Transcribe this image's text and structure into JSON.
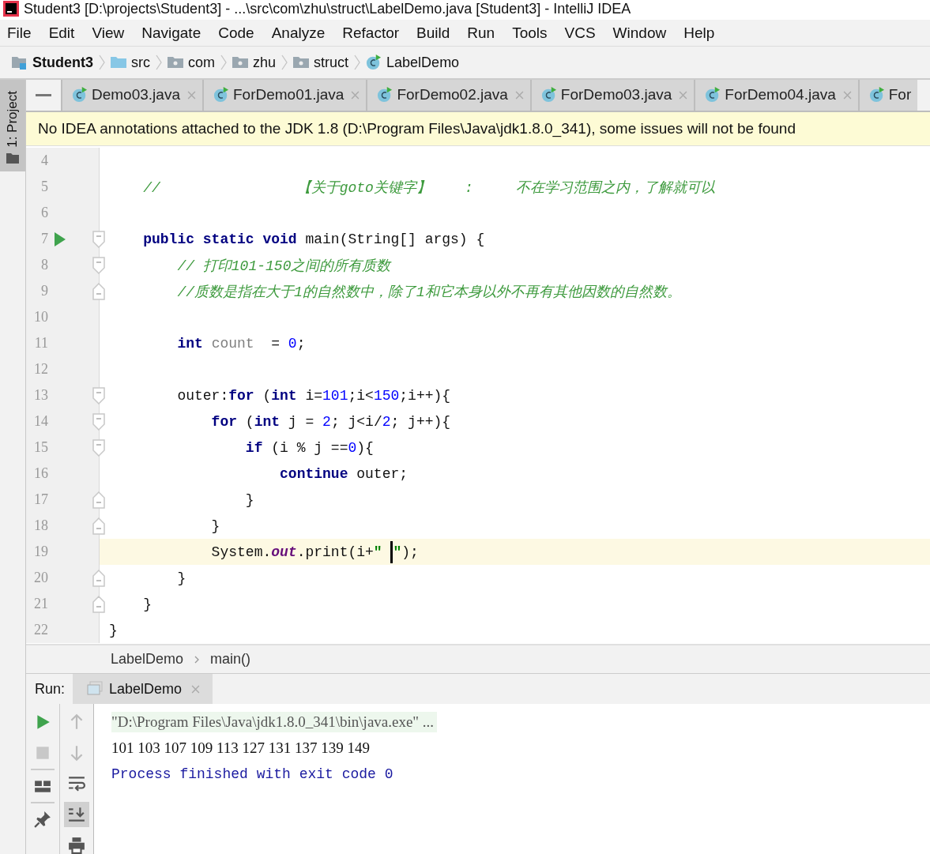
{
  "window": {
    "title": "Student3 [D:\\projects\\Student3] - ...\\src\\com\\zhu\\struct\\LabelDemo.java [Student3] - IntelliJ IDEA"
  },
  "menu": [
    "File",
    "Edit",
    "View",
    "Navigate",
    "Code",
    "Analyze",
    "Refactor",
    "Build",
    "Run",
    "Tools",
    "VCS",
    "Window",
    "Help"
  ],
  "breadcrumb": [
    {
      "kind": "project",
      "label": "Student3"
    },
    {
      "kind": "source",
      "label": "src"
    },
    {
      "kind": "package",
      "label": "com"
    },
    {
      "kind": "package",
      "label": "zhu"
    },
    {
      "kind": "package",
      "label": "struct"
    },
    {
      "kind": "class",
      "label": "LabelDemo"
    }
  ],
  "tool_window_tab": {
    "label": "1: Project",
    "selected": true
  },
  "tabs": [
    {
      "label": "Demo03.java",
      "selected": false
    },
    {
      "label": "ForDemo01.java",
      "selected": false
    },
    {
      "label": "ForDemo02.java",
      "selected": false
    },
    {
      "label": "ForDemo03.java",
      "selected": false
    },
    {
      "label": "ForDemo04.java",
      "selected": false
    },
    {
      "label": "For",
      "selected": false
    }
  ],
  "notice": "No IDEA annotations attached to the JDK 1.8 (D:\\Program Files\\Java\\jdk1.8.0_341), some issues will not be found",
  "code": [
    {
      "number": "4"
    },
    {
      "number": "5",
      "tokens": [
        {
          "kind": "comment",
          "text": "    //                【关于goto关键字】    :     不在学习范围之内，了解就可以"
        }
      ]
    },
    {
      "number": "6"
    },
    {
      "number": "7",
      "run": true,
      "fold_start": true,
      "tokens": [
        {
          "kind": "keyword",
          "text": "    public static void"
        },
        {
          "kind": "plain",
          "text": " main(String[] args) {"
        }
      ]
    },
    {
      "number": "8",
      "fold_start": true,
      "tokens": [
        {
          "kind": "comment",
          "text": "        // 打印101-150之间的所有质数"
        }
      ]
    },
    {
      "number": "9",
      "fold_end": true,
      "tokens": [
        {
          "kind": "comment",
          "text": "        //质数是指在大于1的自然数中，除了1和它本身以外不再有其他因数的自然数。"
        }
      ]
    },
    {
      "number": "10"
    },
    {
      "number": "11",
      "tokens": [
        {
          "kind": "keyword",
          "text": "        int"
        },
        {
          "kind": "unused",
          "text": " count"
        },
        {
          "kind": "plain",
          "text": "  = "
        },
        {
          "kind": "number",
          "text": "0"
        },
        {
          "kind": "plain",
          "text": ";"
        }
      ]
    },
    {
      "number": "12"
    },
    {
      "number": "13",
      "fold_start": true,
      "tokens": [
        {
          "kind": "plain",
          "text": "        outer:"
        },
        {
          "kind": "keyword",
          "text": "for"
        },
        {
          "kind": "plain",
          "text": " ("
        },
        {
          "kind": "keyword",
          "text": "int"
        },
        {
          "kind": "plain",
          "text": " i="
        },
        {
          "kind": "number",
          "text": "101"
        },
        {
          "kind": "plain",
          "text": ";i<"
        },
        {
          "kind": "number",
          "text": "150"
        },
        {
          "kind": "plain",
          "text": ";i++){"
        }
      ]
    },
    {
      "number": "14",
      "fold_start": true,
      "tokens": [
        {
          "kind": "keyword",
          "text": "            for"
        },
        {
          "kind": "plain",
          "text": " ("
        },
        {
          "kind": "keyword",
          "text": "int"
        },
        {
          "kind": "plain",
          "text": " j = "
        },
        {
          "kind": "number",
          "text": "2"
        },
        {
          "kind": "plain",
          "text": "; j<i/"
        },
        {
          "kind": "number",
          "text": "2"
        },
        {
          "kind": "plain",
          "text": "; j++){"
        }
      ]
    },
    {
      "number": "15",
      "fold_start": true,
      "tokens": [
        {
          "kind": "keyword",
          "text": "                if"
        },
        {
          "kind": "plain",
          "text": " (i % j =="
        },
        {
          "kind": "number",
          "text": "0"
        },
        {
          "kind": "plain",
          "text": "){"
        }
      ]
    },
    {
      "number": "16",
      "tokens": [
        {
          "kind": "keyword",
          "text": "                    continue"
        },
        {
          "kind": "plain",
          "text": " outer;"
        }
      ]
    },
    {
      "number": "17",
      "fold_end": true,
      "tokens": [
        {
          "kind": "plain",
          "text": "                }"
        }
      ]
    },
    {
      "number": "18",
      "fold_end": true,
      "tokens": [
        {
          "kind": "plain",
          "text": "            }"
        }
      ]
    },
    {
      "number": "19",
      "current": true,
      "tokens": [
        {
          "kind": "plain",
          "text": "            System."
        },
        {
          "kind": "field",
          "text": "out"
        },
        {
          "kind": "plain",
          "text": ".print(i+"
        },
        {
          "kind": "string",
          "text": "\" "
        },
        {
          "kind": "string",
          "text": "\"",
          "caret_before": true
        },
        {
          "kind": "plain",
          "text": ");"
        }
      ]
    },
    {
      "number": "20",
      "fold_end": true,
      "tokens": [
        {
          "kind": "plain",
          "text": "        }"
        }
      ]
    },
    {
      "number": "21",
      "fold_end": true,
      "tokens": [
        {
          "kind": "plain",
          "text": "    }"
        }
      ]
    },
    {
      "number": "22",
      "tokens": [
        {
          "kind": "plain",
          "text": "}"
        }
      ]
    }
  ],
  "editor_breadcrumb": [
    "LabelDemo",
    "main()"
  ],
  "run_panel": {
    "label": "Run:",
    "tab": "LabelDemo",
    "scroll_to_end": {
      "on": true
    },
    "console": [
      {
        "kind": "command",
        "text": "\"D:\\Program Files\\Java\\jdk1.8.0_341\\bin\\java.exe\" ..."
      },
      {
        "kind": "output",
        "text": "101 103 107 109 113 127 131 137 139 149"
      },
      {
        "kind": "system",
        "text": "Process finished with exit code 0"
      }
    ]
  }
}
